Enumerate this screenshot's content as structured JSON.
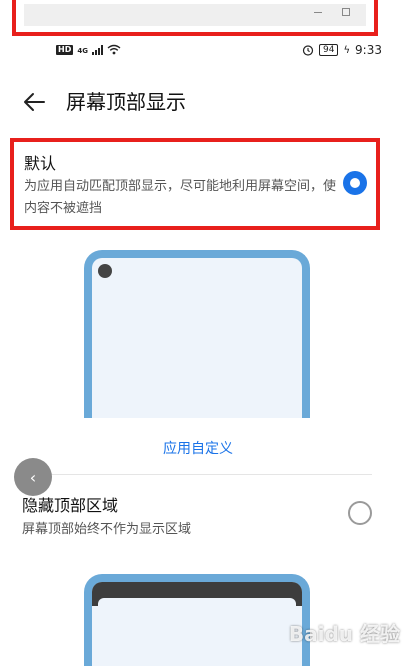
{
  "status_bar": {
    "hd": "HD",
    "network": "4G",
    "battery": "94",
    "time": "9:33"
  },
  "header": {
    "title": "屏幕顶部显示"
  },
  "options": {
    "default": {
      "title": "默认",
      "description": "为应用自动匹配顶部显示，尽可能地利用屏幕空间，使内容不被遮挡",
      "selected": true
    },
    "custom_link": "应用自定义",
    "hide": {
      "title": "隐藏顶部区域",
      "description": "屏幕顶部始终不作为显示区域",
      "selected": false
    }
  },
  "watermark": "Baidu 经验",
  "colors": {
    "accent": "#1a73e8",
    "highlight": "#e8201c",
    "phone_frame": "#6aa9d8"
  }
}
